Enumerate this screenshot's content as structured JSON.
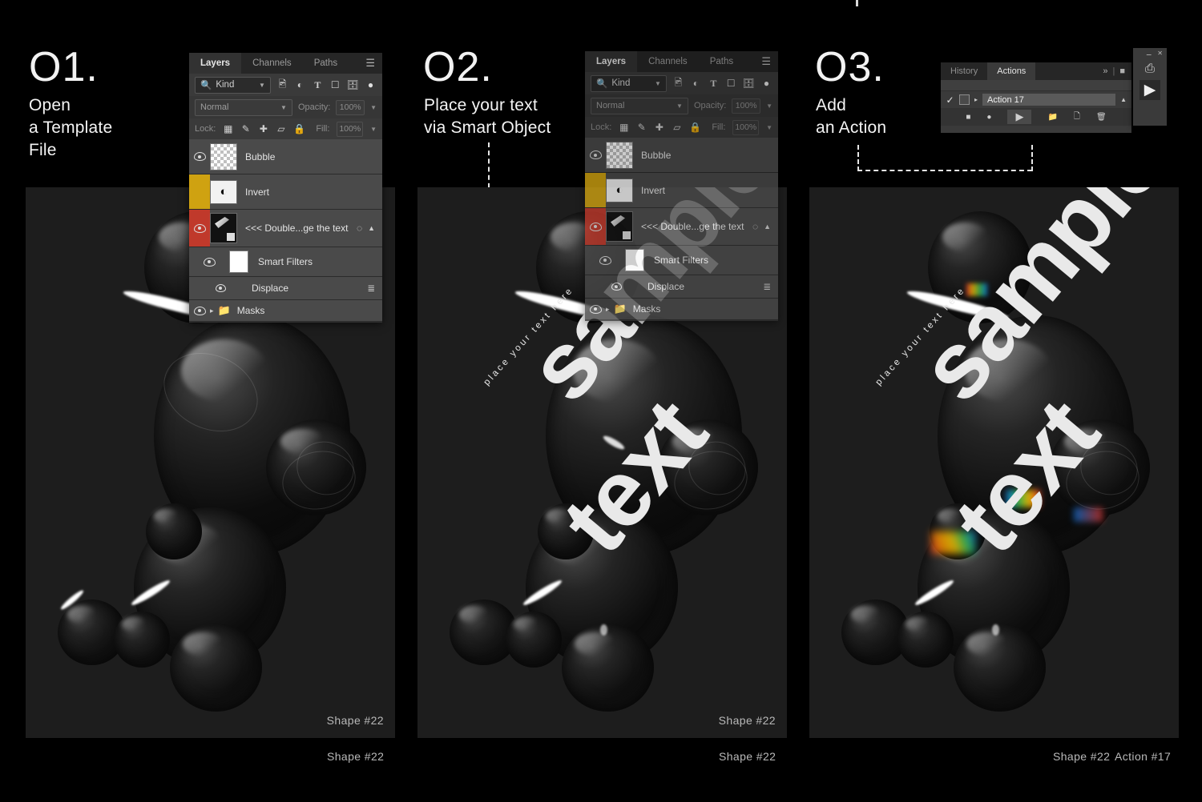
{
  "meta": {
    "background_color": "#000000",
    "artwork_bg_color": "#1d1d1d",
    "panel_bg_color": "#323232",
    "accent_yellow": "#cfa211",
    "accent_red": "#c0392b"
  },
  "steps": [
    {
      "number": "O1.",
      "description": "Open\na Template\nFile",
      "caption": "Shape #22",
      "caption2": "",
      "artwork_overlay_text": ""
    },
    {
      "number": "O2.",
      "description": "Place your  text\nvia Smart Object",
      "caption": "Shape #22",
      "caption2": "",
      "artwork_overlay_text": "place your text here",
      "big_text_lines": [
        "sample",
        "text"
      ]
    },
    {
      "number": "O3.",
      "description": "Add\nan Action",
      "caption": "Shape #22",
      "caption2": "Action #17",
      "artwork_overlay_text": "place your text here",
      "big_text_lines": [
        "sample",
        "text"
      ]
    }
  ],
  "layers_panel": {
    "tabs": [
      {
        "label": "Layers",
        "active": true
      },
      {
        "label": "Channels",
        "active": false
      },
      {
        "label": "Paths",
        "active": false
      }
    ],
    "menu_icon": "hamburger-icon",
    "filter": {
      "search_icon": "search-icon",
      "kind_label": "Kind",
      "chevron": "chevron-down-icon"
    },
    "filter_icons": [
      "image-filter-icon",
      "adjustment-filter-icon",
      "type-filter-icon",
      "shape-filter-icon",
      "smartobject-filter-icon"
    ],
    "filter_toggle": "filter-toggle-knob",
    "blend_mode": "Normal",
    "opacity_label": "Opacity:",
    "opacity_value": "100%",
    "lock_label": "Lock:",
    "lock_icons": [
      "lock-transparent-pixels-icon",
      "lock-image-pixels-icon",
      "lock-position-icon",
      "lock-artboard-nesting-icon",
      "lock-all-icon"
    ],
    "fill_label": "Fill:",
    "fill_value": "100%",
    "layers": [
      {
        "name": "Bubble",
        "visible": true,
        "thumb": "checker-bubble-thumb",
        "marker": "none"
      },
      {
        "name": "Invert",
        "visible": false,
        "thumb": "invert-adjustment-thumb",
        "marker": "yellow"
      },
      {
        "name": "<<<  Double...ge the text",
        "visible": true,
        "thumb": "smart-object-thumb",
        "marker": "red",
        "right_icons": [
          "smart-filter-icon",
          "collapse-chevron-icon"
        ]
      }
    ],
    "smart_filters_label": "Smart Filters",
    "displace_label": "Displace",
    "displace_icon": "filter-settings-icon",
    "masks_group_label": "Masks"
  },
  "actions_panel": {
    "tabs": [
      {
        "label": "History",
        "active": false
      },
      {
        "label": "Actions",
        "active": true
      }
    ],
    "header_icons": [
      "expand-chevrons-icon",
      "panel-menu-icon"
    ],
    "row": {
      "check": "✓",
      "toggle_box": "dialog-toggle-box",
      "expand": "expand-arrow-icon",
      "name": "Action 17",
      "collapse": "collapse-chevron-icon"
    },
    "buttons": [
      "stop-button",
      "record-button",
      "play-button",
      "new-set-button",
      "new-action-button",
      "delete-button"
    ]
  },
  "mini_toolbar": {
    "minimize": "minimize-icon",
    "close": "close-icon",
    "buttons": [
      "step-record-icon",
      "play-action-icon"
    ]
  }
}
